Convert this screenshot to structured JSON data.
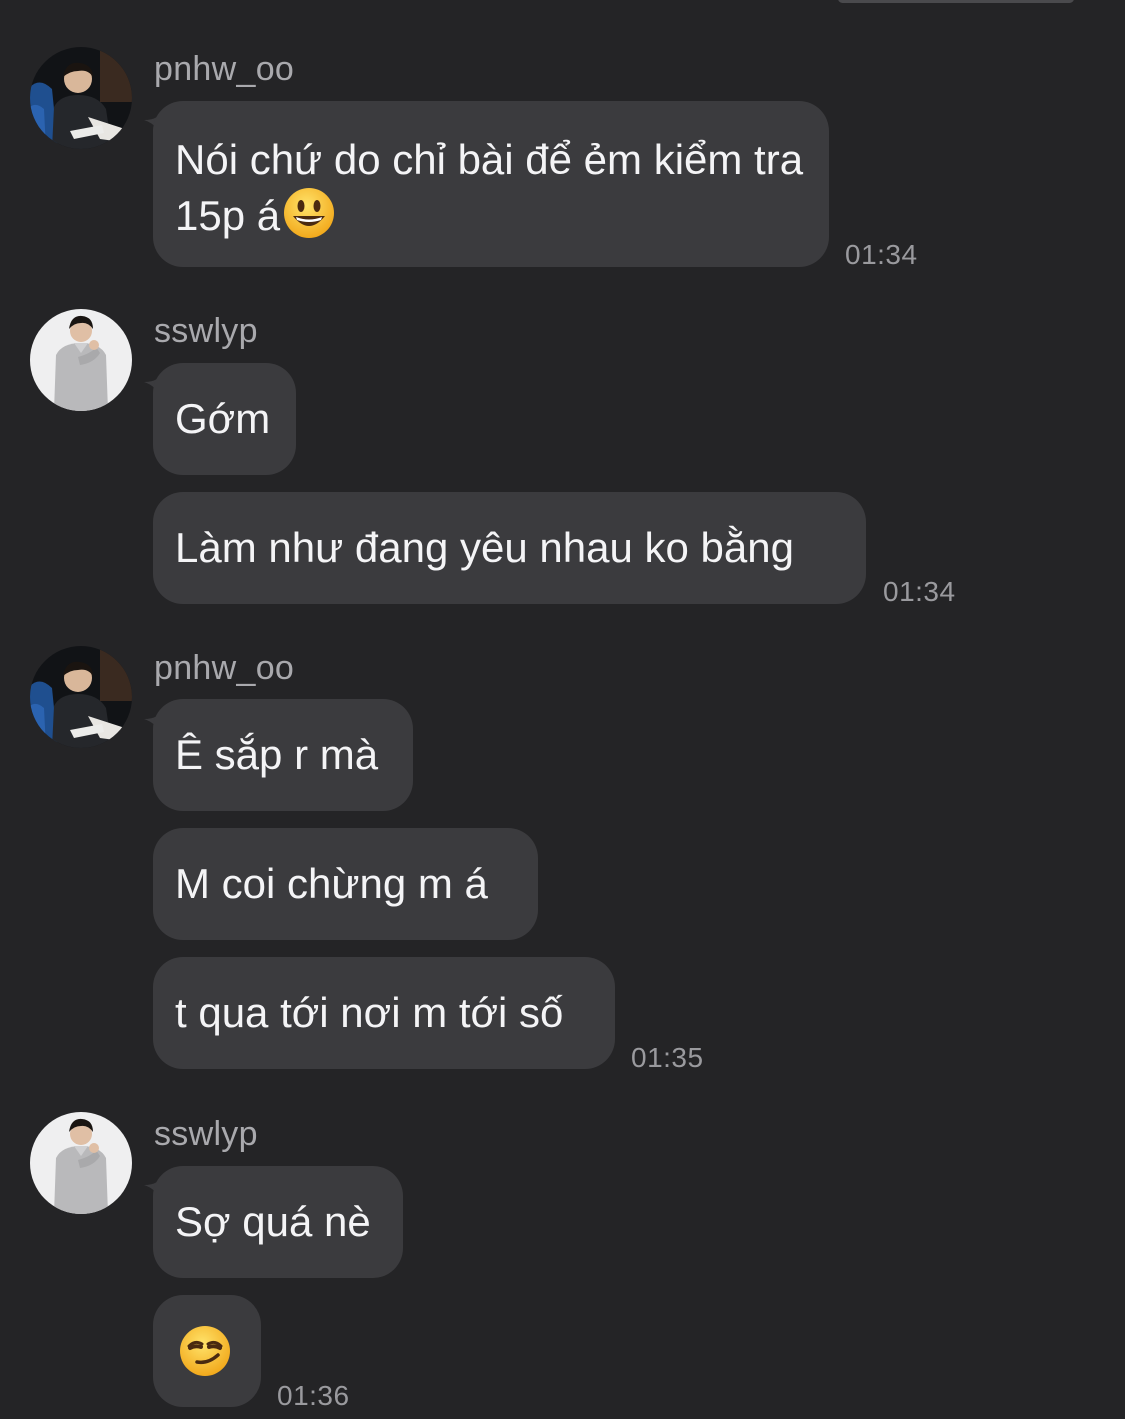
{
  "messages": [
    {
      "sender": "pnhw_oo",
      "avatar": "avatar-dark-jacket",
      "texts": [
        "Nói chứ do chỉ bài để ẻm kiểm tra 15p á"
      ],
      "emoji": "grinning-face-emoji",
      "time": "01:34"
    },
    {
      "sender": "sswlyp",
      "avatar": "avatar-grey-sweater",
      "texts": [
        "Gớm",
        "Làm như đang yêu nhau ko bằng"
      ],
      "time": "01:34"
    },
    {
      "sender": "pnhw_oo",
      "avatar": "avatar-dark-jacket",
      "texts": [
        "Ê sắp r mà",
        "M coi chừng m á",
        "t qua tới nơi m tới số"
      ],
      "time": "01:35"
    },
    {
      "sender": "sswlyp",
      "avatar": "avatar-grey-sweater",
      "texts": [
        "Sợ quá nè"
      ],
      "emoji_message": "smirking-face-emoji",
      "time": "01:36"
    }
  ],
  "colors": {
    "background": "#242426",
    "bubble": "#3b3b3e",
    "text": "#f4f4f6",
    "sender": "#a9a9ad",
    "timestamp": "#9a9a9e"
  }
}
